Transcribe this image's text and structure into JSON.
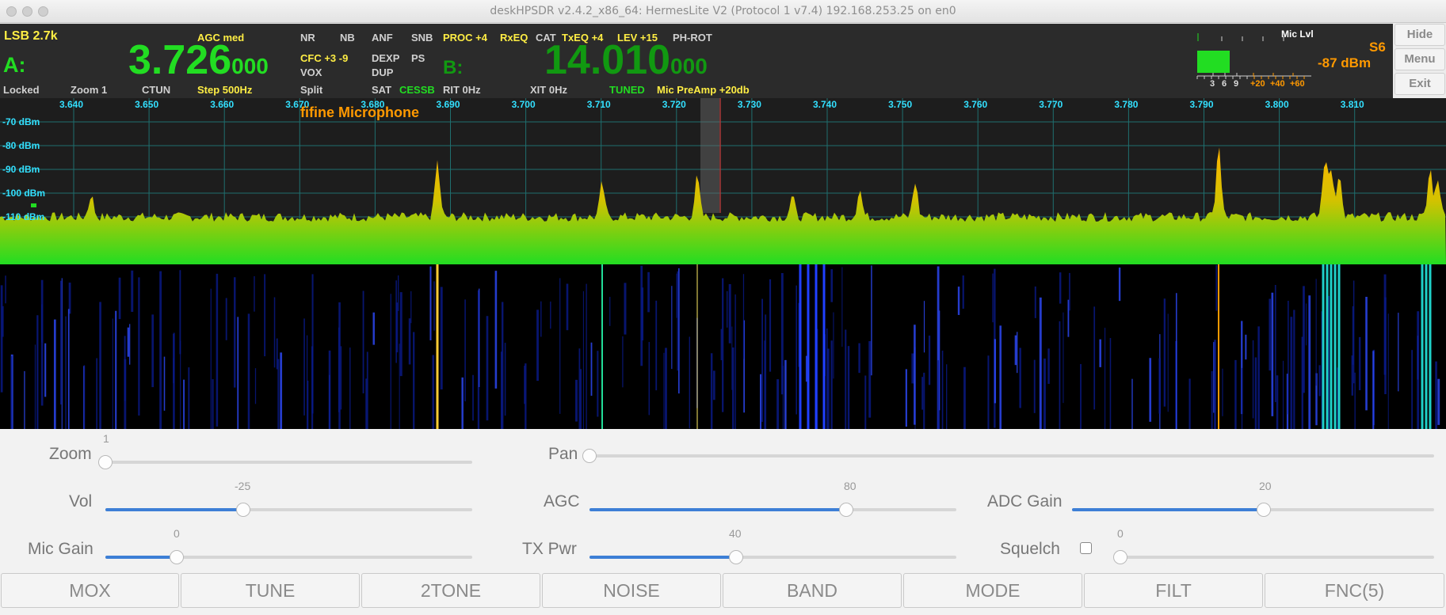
{
  "window": {
    "title": "deskHPSDR v2.4.2_x86_64: HermesLite V2 (Protocol 1 v7.4) 192.168.253.25 on en0"
  },
  "vfo": {
    "mode": "LSB 2.7k",
    "agc": "AGC med",
    "a_label": "A:",
    "a_freq_main": "3.726",
    "a_freq_sub": "000",
    "b_label": "B:",
    "b_freq_main": "14.010",
    "b_freq_sub": "000",
    "locked": "Locked",
    "zoom": "Zoom 1",
    "ctun": "CTUN",
    "step": "Step 500Hz",
    "split": "Split",
    "sat": "SAT",
    "cessb": "CESSB",
    "rit": "RIT 0Hz",
    "xit": "XIT 0Hz",
    "tuned": "TUNED",
    "mic_preamp": "Mic PreAmp +20db",
    "nr": "NR",
    "nb": "NB",
    "anf": "ANF",
    "snb": "SNB",
    "proc": "PROC +4",
    "rxeq": "RxEQ",
    "cat": "CAT",
    "txeq": "TxEQ +4",
    "lev": "LEV +15",
    "phrot": "PH-ROT",
    "cfc": "CFC +3 -9",
    "vox": "VOX",
    "dexp": "DEXP",
    "ps": "PS",
    "dup": "DUP"
  },
  "meter": {
    "label": "Mic Lvl",
    "s_value": "S6",
    "dbm": "-87 dBm",
    "scale": [
      "3",
      "6",
      "9",
      "+20",
      "+40",
      "+60"
    ],
    "level": 0.12
  },
  "side_buttons": {
    "hide": "Hide",
    "menu": "Menu",
    "exit": "Exit"
  },
  "spectrum": {
    "freq_ticks": [
      "3.640",
      "3.650",
      "3.660",
      "3.670",
      "3.680",
      "3.690",
      "3.700",
      "3.710",
      "3.720",
      "3.730",
      "3.740",
      "3.750",
      "3.760",
      "3.770",
      "3.780",
      "3.790",
      "3.800",
      "3.810"
    ],
    "db_ticks": [
      "-70 dBm",
      "-80 dBm",
      "-90 dBm",
      "-100 dBm",
      "-110 dBm"
    ],
    "mic_label": "fifine Microphone",
    "colors": {
      "grid": "#1f6f6f",
      "trace_top": "#ffb300",
      "trace_bottom": "#22dd22",
      "tick_text": "#33e0ff"
    }
  },
  "sliders": {
    "zoom": {
      "label": "Zoom",
      "value": "1",
      "level": 0.0
    },
    "pan": {
      "label": "Pan",
      "level": 0.0
    },
    "vol": {
      "label": "Vol",
      "value": "-25",
      "level": 0.375
    },
    "agc": {
      "label": "AGC",
      "value": "80",
      "level": 0.7
    },
    "adc": {
      "label": "ADC Gain",
      "value": "20",
      "level": 0.53
    },
    "mic": {
      "label": "Mic Gain",
      "value": "0",
      "level": 0.195
    },
    "txpwr": {
      "label": "TX Pwr",
      "value": "40",
      "level": 0.4
    },
    "squelch": {
      "label": "Squelch",
      "value": "0",
      "level": 0.0
    }
  },
  "buttons": [
    "MOX",
    "TUNE",
    "2TONE",
    "NOISE",
    "BAND",
    "MODE",
    "FILT",
    "FNC(5)"
  ]
}
